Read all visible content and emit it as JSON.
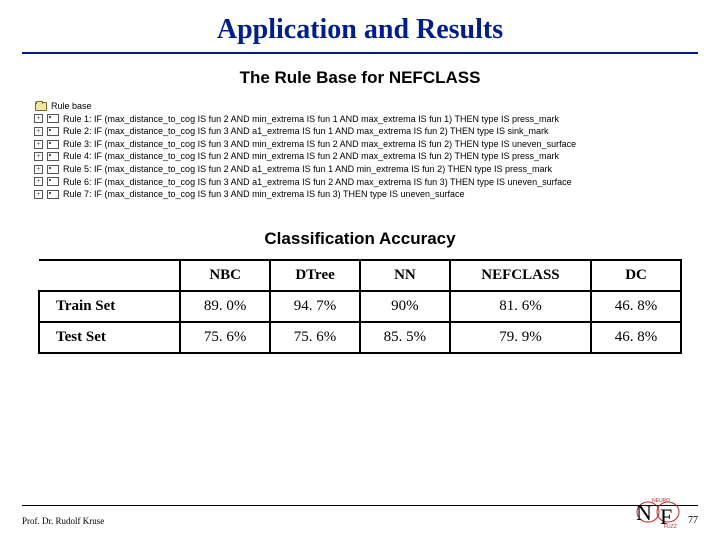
{
  "title": "Application and Results",
  "section_rulebase": "The Rule Base for NEFCLASS",
  "rule_root_label": "Rule base",
  "rules": [
    "Rule 1: IF (max_distance_to_cog IS fun 2 AND min_extrema IS fun 1 AND max_extrema IS fun 1) THEN type IS press_mark",
    "Rule 2: IF (max_distance_to_cog IS fun 3 AND a1_extrema IS fun 1 AND max_extrema IS fun 2) THEN type IS sink_mark",
    "Rule 3: IF (max_distance_to_cog IS fun 3 AND min_extrema IS fun 2 AND max_extrema IS fun 2) THEN type IS uneven_surface",
    "Rule 4: IF (max_distance_to_cog IS fun 2 AND min_extrema IS fun 2 AND max_extrema IS fun 2) THEN type IS press_mark",
    "Rule 5: IF (max_distance_to_cog IS fun 2 AND a1_extrema IS fun 1 AND min_extrema IS fun 2) THEN type IS press_mark",
    "Rule 6: IF (max_distance_to_cog IS fun 3 AND a1_extrema IS fun 2 AND max_extrema IS fun 3) THEN type IS uneven_surface",
    "Rule 7: IF (max_distance_to_cog IS fun 3 AND min_extrema IS fun 3) THEN type IS uneven_surface"
  ],
  "section_accuracy": "Classification Accuracy",
  "table": {
    "cols": [
      "NBC",
      "DTree",
      "NN",
      "NEFCLASS",
      "DC"
    ],
    "rows": [
      {
        "label": "Train Set",
        "values": [
          "89. 0%",
          "94. 7%",
          "90%",
          "81. 6%",
          "46. 8%"
        ]
      },
      {
        "label": "Test  Set",
        "values": [
          "75. 6%",
          "75. 6%",
          "85. 5%",
          "79. 9%",
          "46. 8%"
        ]
      }
    ]
  },
  "footer": {
    "author": "Prof. Dr. Rudolf Kruse",
    "page": "77"
  },
  "chart_data": {
    "type": "table",
    "title": "Classification Accuracy",
    "columns": [
      "NBC",
      "DTree",
      "NN",
      "NEFCLASS",
      "DC"
    ],
    "rows": [
      "Train Set",
      "Test Set"
    ],
    "values_percent": [
      [
        89.0,
        94.7,
        90.0,
        81.6,
        46.8
      ],
      [
        75.6,
        75.6,
        85.5,
        79.9,
        46.8
      ]
    ]
  }
}
